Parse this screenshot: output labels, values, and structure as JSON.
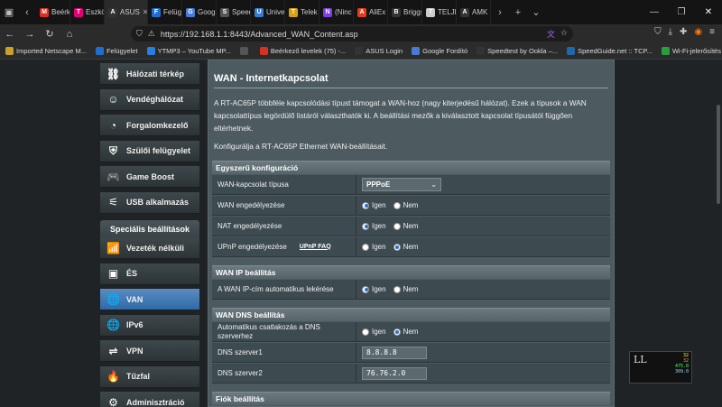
{
  "browser": {
    "tabs": [
      {
        "label": "Beérk",
        "icon": "M",
        "color": "#d93025"
      },
      {
        "label": "Eszkö",
        "icon": "T",
        "color": "#e20074"
      },
      {
        "label": "ASUS",
        "icon": "A",
        "color": "#333333",
        "active": true
      },
      {
        "label": "Felüg",
        "icon": "F",
        "color": "#1f6fd1"
      },
      {
        "label": "Goog",
        "icon": "G",
        "color": "#4a7bd4"
      },
      {
        "label": "Speed",
        "icon": "S",
        "color": "#555555"
      },
      {
        "label": "Unive",
        "icon": "U",
        "color": "#3a7bd5"
      },
      {
        "label": "Telek",
        "icon": "T",
        "color": "#d4a017"
      },
      {
        "label": "(Ninc",
        "icon": "N",
        "color": "#7b3fe4"
      },
      {
        "label": "AliEx",
        "icon": "A",
        "color": "#e43d1f"
      },
      {
        "label": "Briggs St",
        "icon": "B",
        "color": "#333333"
      },
      {
        "label": "TELJE",
        "icon": "T",
        "color": "#cccccc"
      },
      {
        "label": "AMK",
        "icon": "A",
        "color": "#333333"
      }
    ],
    "url": "https://192.168.1.1:8443/Advanced_WAN_Content.asp",
    "bookmarks": [
      {
        "label": "Imported Netscape M...",
        "color": "#c9a227"
      },
      {
        "label": "Felügyelet",
        "color": "#1f6fd1"
      },
      {
        "label": "YTMP3 – YouTube MP...",
        "color": "#2a7de1"
      },
      {
        "label": "",
        "color": "#555555"
      },
      {
        "label": "Beérkező levelek (75) -...",
        "color": "#d93025"
      },
      {
        "label": "ASUS Login",
        "color": "#333333"
      },
      {
        "label": "Google Fordító",
        "color": "#4a7bd4"
      },
      {
        "label": "Speedtest by Ookla –...",
        "color": "#333333"
      },
      {
        "label": "SpeedGuide.net :: TCP...",
        "color": "#2266aa"
      },
      {
        "label": "Wi-Fi-jelerősítés Opel...",
        "color": "#2a9d3f"
      }
    ]
  },
  "sidebar": {
    "items_top": [
      {
        "label": "Hálózati térkép",
        "icon": "network-map-icon",
        "glyph": "⛓"
      },
      {
        "label": "Vendéghálózat",
        "icon": "guest-network-icon",
        "glyph": "☺"
      },
      {
        "label": "Forgalomkezelő",
        "icon": "traffic-manager-icon",
        "glyph": "◔"
      },
      {
        "label": "Szülői felügyelet",
        "icon": "parental-control-icon",
        "glyph": "⛨"
      },
      {
        "label": "Game Boost",
        "icon": "gamepad-icon",
        "glyph": "🎮"
      },
      {
        "label": "USB alkalmazás",
        "icon": "usb-icon",
        "glyph": "⚟"
      }
    ],
    "header": "Speciális beállítások",
    "items_adv": [
      {
        "label": "Vezeték nélküli",
        "icon": "wifi-icon",
        "glyph": "📶"
      },
      {
        "label": "ÉS",
        "icon": "lan-icon",
        "glyph": "▣"
      },
      {
        "label": "VAN",
        "icon": "wan-globe-icon",
        "glyph": "🌐",
        "active": true
      },
      {
        "label": "IPv6",
        "icon": "ipv6-globe-icon",
        "glyph": "🌐"
      },
      {
        "label": "VPN",
        "icon": "vpn-icon",
        "glyph": "⇌"
      },
      {
        "label": "Tűzfal",
        "icon": "firewall-icon",
        "glyph": "🔥"
      },
      {
        "label": "Adminisztráció",
        "icon": "admin-gear-icon",
        "glyph": "⚙"
      }
    ]
  },
  "main": {
    "title": "WAN - Internetkapcsolat",
    "description": "A RT-AC65P többféle kapcsolódási típust támogat a WAN-hoz (nagy kiterjedésű hálózat). Ezek a típusok a WAN kapcsolattípus legördülő listáról választhatók ki. A beállítási mezők a kiválasztott kapcsolat típusától függően eltérhetnek.",
    "config_note": "Konfigurálja a RT-AC65P Ethernet WAN-beállításait.",
    "radio_yes": "Igen",
    "radio_no": "Nem",
    "sections": {
      "basic": {
        "title": "Egyszerű konfiguráció",
        "wan_type_label": "WAN-kapcsolat típusa",
        "wan_type_value": "PPPoE",
        "wan_enable_label": "WAN engedélyezése",
        "nat_enable_label": "NAT engedélyezése",
        "upnp_label": "UPnP engedélyezése",
        "upnp_faq": "UPnP  FAQ"
      },
      "ip": {
        "title": "WAN IP beállítás",
        "auto_ip_label": "A WAN IP-cím automatikus lekérése"
      },
      "dns": {
        "title": "WAN DNS beállítás",
        "auto_dns_label": "Automatikus csatlakozás a DNS szerverhez",
        "dns1_label": "DNS szerver1",
        "dns1_value": "8.8.8.8",
        "dns2_label": "DNS szerver2",
        "dns2_value": "76.76.2.0"
      },
      "account": {
        "title": "Fiók beállítás"
      }
    }
  },
  "widget": {
    "glyph": "LL",
    "values": [
      "",
      "32",
      "32",
      "475.0",
      "309.0"
    ]
  }
}
